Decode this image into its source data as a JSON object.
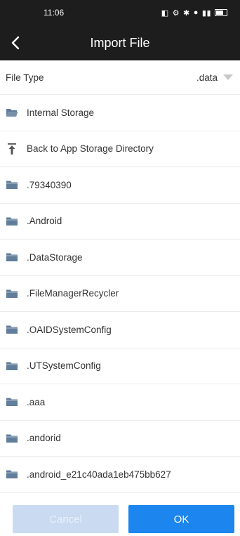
{
  "status_bar": {
    "time": "11:06"
  },
  "header": {
    "title": "Import File"
  },
  "file_type": {
    "label": "File Type",
    "value": ".data"
  },
  "list": [
    {
      "label": "Internal Storage",
      "icon": "folder-open-icon"
    },
    {
      "label": "Back to App Storage Directory",
      "icon": "arrow-up-to-top-icon"
    },
    {
      "label": ".79340390",
      "icon": "folder-icon"
    },
    {
      "label": ".Android",
      "icon": "folder-icon"
    },
    {
      "label": ".DataStorage",
      "icon": "folder-icon"
    },
    {
      "label": ".FileManagerRecycler",
      "icon": "folder-icon"
    },
    {
      "label": ".OAIDSystemConfig",
      "icon": "folder-icon"
    },
    {
      "label": ".UTSystemConfig",
      "icon": "folder-icon"
    },
    {
      "label": ".aaa",
      "icon": "folder-icon"
    },
    {
      "label": ".andorid",
      "icon": "folder-icon"
    },
    {
      "label": ".android_e21c40ada1eb475bb627",
      "icon": "folder-icon"
    }
  ],
  "footer": {
    "cancel_label": "Cancel",
    "ok_label": "OK"
  },
  "colors": {
    "header_bg": "#1d1d1d",
    "folder_icon": "#607d9b",
    "ok_button": "#1c86ee",
    "cancel_button_disabled": "#c9daf1"
  }
}
